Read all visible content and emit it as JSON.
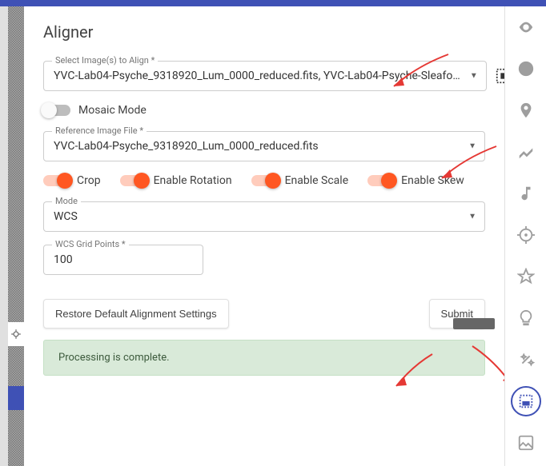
{
  "panel": {
    "title": "Aligner",
    "select_images": {
      "label": "Select Image(s) to Align *",
      "value": "YVC-Lab04-Psyche_9318920_Lum_0000_reduced.fits, YVC-Lab04-Psyche-Sleafo…"
    },
    "mosaic": {
      "label": "Mosaic Mode",
      "on": false
    },
    "reference": {
      "label": "Reference Image File *",
      "value": "YVC-Lab04-Psyche_9318920_Lum_0000_reduced.fits"
    },
    "toggles": {
      "crop": {
        "label": "Crop",
        "on": true
      },
      "rotation": {
        "label": "Enable Rotation",
        "on": true
      },
      "scale": {
        "label": "Enable Scale",
        "on": true
      },
      "skew": {
        "label": "Enable Skew",
        "on": true
      }
    },
    "mode": {
      "label": "Mode",
      "value": "WCS"
    },
    "wcs_points": {
      "label": "WCS Grid Points *",
      "value": "100"
    },
    "buttons": {
      "restore": "Restore Default Alignment Settings",
      "submit": "Submit"
    },
    "status": "Processing is complete."
  },
  "rail": {
    "eye": "Viewer",
    "info": "Info",
    "pin": "Marker",
    "trend": "Plot",
    "note": "Sonify",
    "target": "Centroid",
    "star": "Favorite",
    "bulb": "Tips",
    "wand": "Auto",
    "align": "Aligner",
    "image": "Image"
  }
}
